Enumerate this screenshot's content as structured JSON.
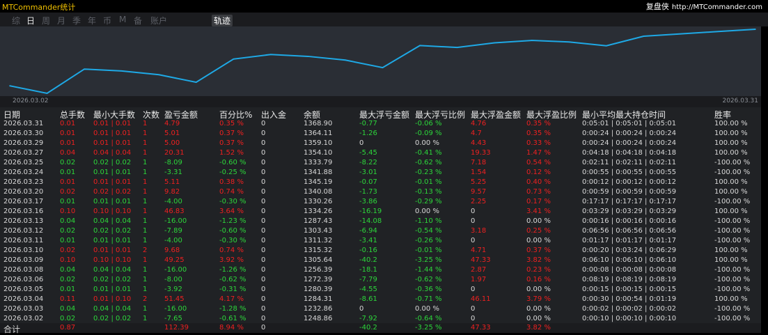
{
  "app": {
    "title": "MTCommander统计",
    "brand": "复盘侠",
    "url": "http://MTCommander.com"
  },
  "tabs": [
    {
      "label": "综",
      "active": false
    },
    {
      "label": "日",
      "active": true
    },
    {
      "label": "周",
      "active": false
    },
    {
      "label": "月",
      "active": false
    },
    {
      "label": "季",
      "active": false
    },
    {
      "label": "年",
      "active": false
    },
    {
      "label": "币",
      "active": false
    },
    {
      "label": "M",
      "active": false
    },
    {
      "label": "备",
      "active": false
    },
    {
      "label": "账户",
      "active": false
    },
    {
      "label": "轨迹",
      "active": true
    }
  ],
  "chart_data": {
    "type": "line",
    "x_start_label": "2026.03.02",
    "x_end_label": "2026.03.31",
    "x": [
      "2026.03.02",
      "2026.03.03",
      "2026.03.04",
      "2026.03.05",
      "2026.03.06",
      "2026.03.08",
      "2026.03.09",
      "2026.03.10",
      "2026.03.11",
      "2026.03.12",
      "2026.03.13",
      "2026.03.16",
      "2026.03.17",
      "2026.03.20",
      "2026.03.23",
      "2026.03.24",
      "2026.03.25",
      "2026.03.27",
      "2026.03.29",
      "2026.03.30",
      "2026.03.31"
    ],
    "values": [
      1248.86,
      1232.86,
      1284.31,
      1280.39,
      1272.39,
      1256.39,
      1305.64,
      1315.32,
      1311.32,
      1303.43,
      1287.43,
      1334.26,
      1330.26,
      1340.08,
      1345.19,
      1341.88,
      1333.79,
      1354.1,
      1359.1,
      1364.11,
      1368.9
    ],
    "line_color": "#1ea9e6",
    "grid": false
  },
  "table": {
    "headers": [
      "日期",
      "总手数",
      "最小大手数",
      "次数",
      "盈亏金额",
      "百分比%",
      "出入金",
      "余额",
      "最大浮亏金额",
      "最大浮亏比例",
      "最大浮盈金额",
      "最大浮盈比例",
      "最小平均最大持仓时间",
      "胜率"
    ],
    "rows": [
      [
        "2026.03.31",
        "0.01",
        "0.01 | 0.01",
        "1",
        "4.79",
        "0.35 %",
        "0",
        "1368.90",
        "-0.77",
        "-0.06 %",
        "4.76",
        "0.35 %",
        "0:05:01 | 0:05:01 | 0:05:01",
        "100.00 %"
      ],
      [
        "2026.03.30",
        "0.01",
        "0.01 | 0.01",
        "1",
        "5.01",
        "0.37 %",
        "0",
        "1364.11",
        "-1.26",
        "-0.09 %",
        "4.7",
        "0.35 %",
        "0:00:24 | 0:00:24 | 0:00:24",
        "100.00 %"
      ],
      [
        "2026.03.29",
        "0.01",
        "0.01 | 0.01",
        "1",
        "5.00",
        "0.37 %",
        "0",
        "1359.10",
        "0",
        "0.00 %",
        "4.43",
        "0.33 %",
        "0:00:24 | 0:00:24 | 0:00:24",
        "100.00 %"
      ],
      [
        "2026.03.27",
        "0.04",
        "0.04 | 0.04",
        "1",
        "20.31",
        "1.52 %",
        "0",
        "1354.10",
        "-5.45",
        "-0.41 %",
        "19.33",
        "1.47 %",
        "0:04:18 | 0:04:18 | 0:04:18",
        "100.00 %"
      ],
      [
        "2026.03.25",
        "0.02",
        "0.02 | 0.02",
        "1",
        "-8.09",
        "-0.60 %",
        "0",
        "1333.79",
        "-8.22",
        "-0.62 %",
        "7.18",
        "0.54 %",
        "0:02:11 | 0:02:11 | 0:02:11",
        "-100.00 %"
      ],
      [
        "2026.03.24",
        "0.01",
        "0.01 | 0.01",
        "1",
        "-3.31",
        "-0.25 %",
        "0",
        "1341.88",
        "-3.01",
        "-0.23 %",
        "1.54",
        "0.12 %",
        "0:00:55 | 0:00:55 | 0:00:55",
        "-100.00 %"
      ],
      [
        "2026.03.23",
        "0.01",
        "0.01 | 0.01",
        "1",
        "5.11",
        "0.38 %",
        "0",
        "1345.19",
        "-0.07",
        "-0.01 %",
        "5.25",
        "0.40 %",
        "0:00:12 | 0:00:12 | 0:00:12",
        "100.00 %"
      ],
      [
        "2026.03.20",
        "0.02",
        "0.02 | 0.02",
        "1",
        "9.82",
        "0.74 %",
        "0",
        "1340.08",
        "-1.73",
        "-0.13 %",
        "9.57",
        "0.73 %",
        "0:00:59 | 0:00:59 | 0:00:59",
        "100.00 %"
      ],
      [
        "2026.03.17",
        "0.01",
        "0.01 | 0.01",
        "1",
        "-4.00",
        "-0.30 %",
        "0",
        "1330.26",
        "-3.86",
        "-0.29 %",
        "2.25",
        "0.17 %",
        "0:17:17 | 0:17:17 | 0:17:17",
        "-100.00 %"
      ],
      [
        "2026.03.16",
        "0.10",
        "0.10 | 0.10",
        "1",
        "46.83",
        "3.64 %",
        "0",
        "1334.26",
        "-16.19",
        "0.00 %",
        "0",
        "3.41 %",
        "0:03:29 | 0:03:29 | 0:03:29",
        "100.00 %"
      ],
      [
        "2026.03.13",
        "0.04",
        "0.04 | 0.04",
        "1",
        "-16.00",
        "-1.23 %",
        "0",
        "1287.43",
        "-14.08",
        "-1.10 %",
        "0",
        "0.00 %",
        "0:00:16 | 0:00:16 | 0:00:16",
        "-100.00 %"
      ],
      [
        "2026.03.12",
        "0.02",
        "0.02 | 0.02",
        "1",
        "-7.89",
        "-0.60 %",
        "0",
        "1303.43",
        "-6.94",
        "-0.54 %",
        "3.18",
        "0.25 %",
        "0:06:56 | 0:06:56 | 0:06:56",
        "-100.00 %"
      ],
      [
        "2026.03.11",
        "0.01",
        "0.01 | 0.01",
        "1",
        "-4.00",
        "-0.30 %",
        "0",
        "1311.32",
        "-3.41",
        "-0.26 %",
        "0",
        "0.00 %",
        "0:01:17 | 0:01:17 | 0:01:17",
        "-100.00 %"
      ],
      [
        "2026.03.10",
        "0.02",
        "0.01 | 0.01",
        "2",
        "9.68",
        "0.74 %",
        "0",
        "1315.32",
        "-0.16",
        "-0.01 %",
        "4.71",
        "0.37 %",
        "0:00:20 | 0:03:24 | 0:06:29",
        "100.00 %"
      ],
      [
        "2026.03.09",
        "0.10",
        "0.10 | 0.10",
        "1",
        "49.25",
        "3.92 %",
        "0",
        "1305.64",
        "-40.2",
        "-3.25 %",
        "47.33",
        "3.82 %",
        "0:06:10 | 0:06:10 | 0:06:10",
        "100.00 %"
      ],
      [
        "2026.03.08",
        "0.04",
        "0.04 | 0.04",
        "1",
        "-16.00",
        "-1.26 %",
        "0",
        "1256.39",
        "-18.1",
        "-1.44 %",
        "2.87",
        "0.23 %",
        "0:00:08 | 0:00:08 | 0:00:08",
        "-100.00 %"
      ],
      [
        "2026.03.06",
        "0.02",
        "0.02 | 0.02",
        "1",
        "-8.00",
        "-0.62 %",
        "0",
        "1272.39",
        "-7.79",
        "-0.62 %",
        "1.97",
        "0.16 %",
        "0:08:19 | 0:08:19 | 0:08:19",
        "-100.00 %"
      ],
      [
        "2026.03.05",
        "0.01",
        "0.01 | 0.01",
        "1",
        "-3.92",
        "-0.31 %",
        "0",
        "1280.39",
        "-4.55",
        "-0.36 %",
        "0",
        "0.00 %",
        "0:00:15 | 0:00:15 | 0:00:15",
        "-100.00 %"
      ],
      [
        "2026.03.04",
        "0.11",
        "0.01 | 0.10",
        "2",
        "51.45",
        "4.17 %",
        "0",
        "1284.31",
        "-8.61",
        "-0.71 %",
        "46.11",
        "3.79 %",
        "0:00:30 | 0:00:54 | 0:01:19",
        "100.00 %"
      ],
      [
        "2026.03.03",
        "0.04",
        "0.04 | 0.04",
        "1",
        "-16.00",
        "-1.28 %",
        "0",
        "1232.86",
        "0",
        "0.00 %",
        "0",
        "0.00 %",
        "0:00:02 | 0:00:02 | 0:00:02",
        "-100.00 %"
      ],
      [
        "2026.03.02",
        "0.02",
        "0.02 | 0.02",
        "1",
        "-7.65",
        "-0.61 %",
        "0",
        "1248.86",
        "-7.92",
        "-0.64 %",
        "0",
        "0.00 %",
        "0:00:10 | 0:00:10 | 0:00:10",
        "-100.00 %"
      ]
    ],
    "total": {
      "label": "合计",
      "lots": "0.87",
      "pnl": "112.39",
      "pct": "8.94 %",
      "flow": "0",
      "max_float_loss": "-40.2",
      "max_float_loss_pct": "-3.25 %",
      "max_float_profit": "47.33",
      "max_float_profit_pct": "3.82 %"
    }
  },
  "colors": {
    "profit": "#ee2020",
    "loss": "#2cd63a",
    "neutral": "#d9d9d9",
    "accent": "#f0c000"
  }
}
